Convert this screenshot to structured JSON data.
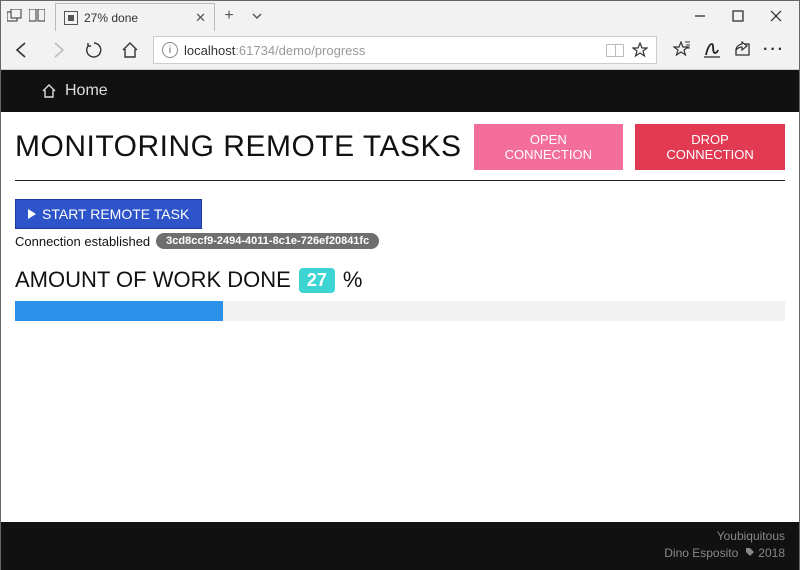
{
  "browser": {
    "tab_title": "27% done",
    "url_host": "localhost",
    "url_port_path": ":61734/demo/progress"
  },
  "nav": {
    "home_label": "Home"
  },
  "header": {
    "title": "MONITORING REMOTE TASKS",
    "open_btn": "OPEN CONNECTION",
    "drop_btn": "DROP CONNECTION"
  },
  "actions": {
    "start_btn": "START REMOTE TASK"
  },
  "status": {
    "label": "Connection established",
    "conn_id": "3cd8ccf9-2494-4011-8c1e-726ef20841fc"
  },
  "progress": {
    "label": "AMOUNT OF WORK DONE",
    "percent": "27",
    "percent_suffix": "%",
    "bar_width": "27%"
  },
  "footer": {
    "line1": "Youbiquitous",
    "line2_author": "Dino Esposito",
    "line2_year": "2018"
  }
}
